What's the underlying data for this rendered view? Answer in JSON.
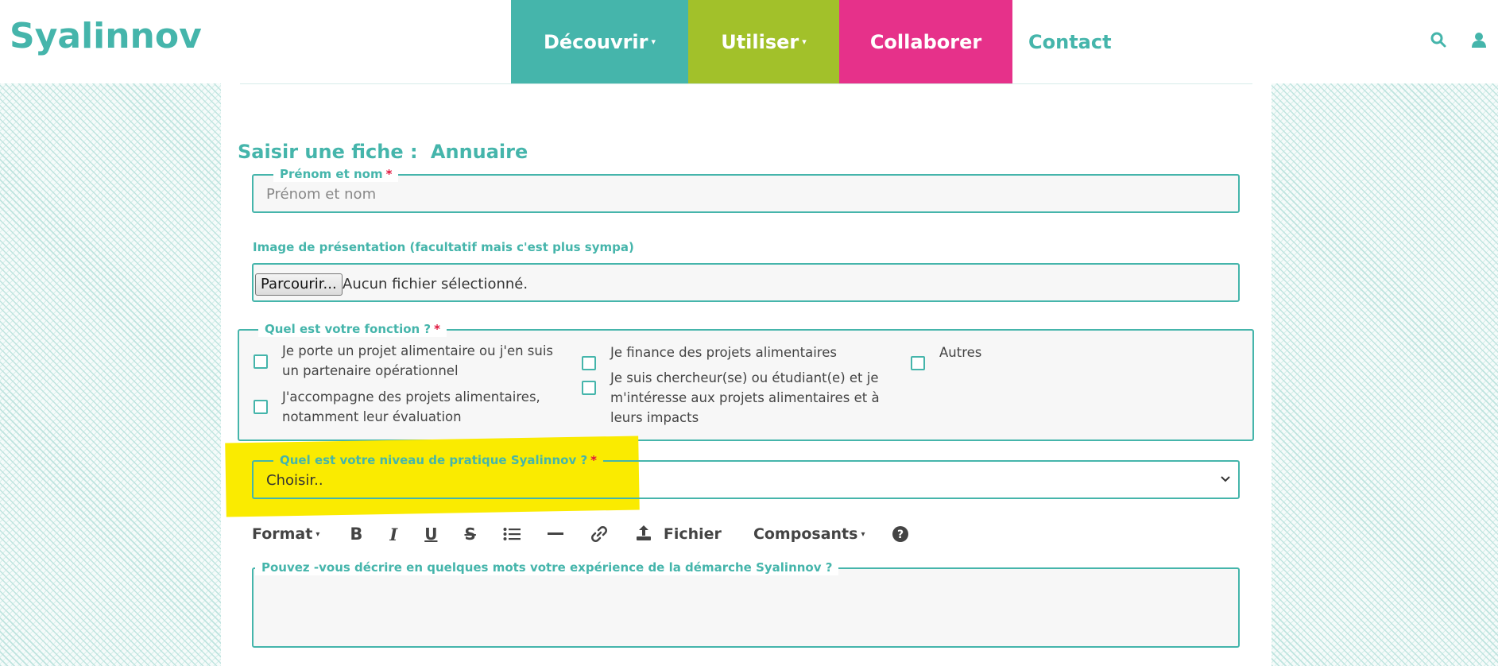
{
  "header": {
    "logo": "Syalinnov",
    "nav": [
      {
        "label": "Découvrir",
        "has_caret": true,
        "color": "#45b5ab"
      },
      {
        "label": "Utiliser",
        "has_caret": true,
        "color": "#a2c12a"
      },
      {
        "label": "Collaborer",
        "has_caret": false,
        "color": "#e6318a"
      },
      {
        "label": "Contact",
        "has_caret": false,
        "color": "#45b5ab"
      }
    ],
    "icons": [
      "search-icon",
      "user-icon"
    ]
  },
  "form": {
    "title": "Saisir une fiche :",
    "form_name": "Annuaire",
    "name_field": {
      "label": "Prénom et nom",
      "placeholder": "Prénom et nom",
      "required": "*"
    },
    "image_field": {
      "label": "Image de présentation (facultatif mais c'est plus sympa)",
      "button": "Parcourir...",
      "status": "Aucun fichier sélectionné."
    },
    "fonction": {
      "label": "Quel est votre fonction ?",
      "required": "*",
      "options": [
        "Je porte un projet alimentaire ou j'en suis un partenaire opérationnel",
        "J'accompagne des projets alimentaires, notamment leur évaluation",
        "Je finance des projets alimentaires",
        "Je suis chercheur(se) ou étudiant(e) et je m'intéresse aux projets alimentaires et à leurs impacts",
        "Autres"
      ]
    },
    "niveau": {
      "label": "Quel est votre niveau de pratique Syalinnov ?",
      "required": "*",
      "value": "Choisir..",
      "highlight_color": "#faeb00"
    },
    "toolbar": {
      "format": "Format",
      "buttons": [
        "bold-icon",
        "italic-icon",
        "underline-icon",
        "strikethrough-icon",
        "list-icon",
        "horizontal-rule-icon",
        "link-icon",
        "upload-icon"
      ],
      "fichier": "Fichier",
      "composants": "Composants",
      "help": "help-icon"
    },
    "experience": {
      "label": "Pouvez -vous décrire en quelques mots votre expérience de la démarche Syalinnov ?",
      "value": ""
    }
  },
  "colors": {
    "teal": "#45b5ab",
    "green": "#a2c12a",
    "pink": "#e6318a",
    "required": "#e0143c"
  }
}
